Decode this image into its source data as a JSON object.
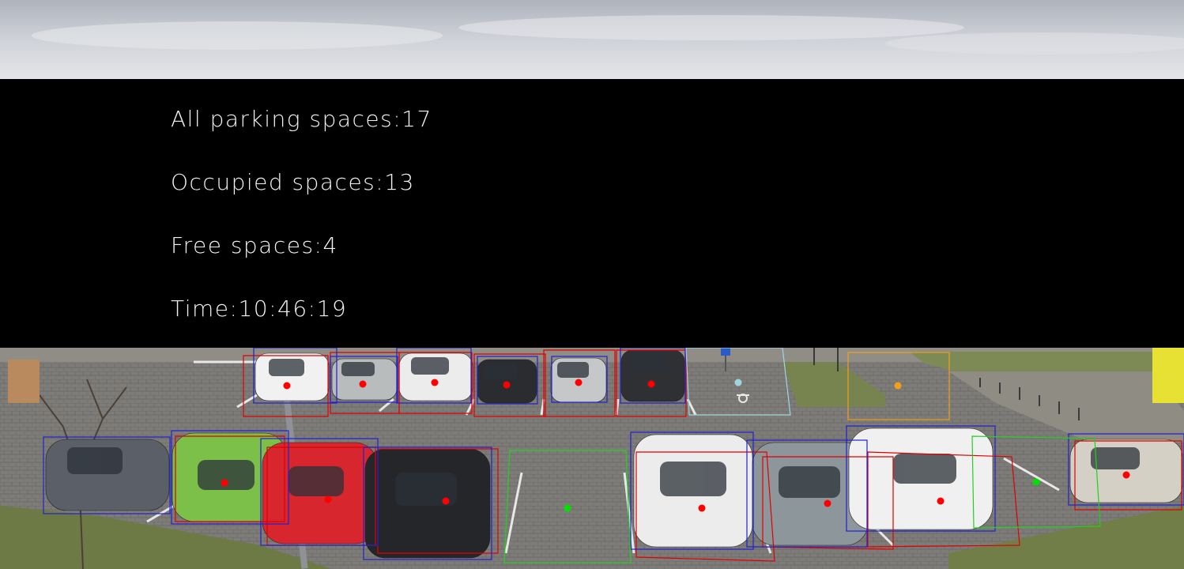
{
  "stats": {
    "all": "All parking spaces:17",
    "occupied": "Occupied spaces:13",
    "free": "Free spaces:4",
    "time": "Time:10:46:19"
  },
  "colors": {
    "occupied_box": "#e00000",
    "vehicle_box": "#2020d0",
    "free_box": "#22d022",
    "free_box_alt": "#9ed6e0",
    "free_box_reserved": "#f0a020",
    "occupied_dot": "#ff0000",
    "free_dot": "#00e000"
  },
  "cars": [
    {
      "color": "#f1f1f1"
    },
    {
      "color": "#b9bcbd"
    },
    {
      "color": "#ececec"
    },
    {
      "color": "#2a2c2f"
    },
    {
      "color": "#c5c7c8"
    },
    {
      "color": "#2e3034"
    },
    {
      "color": "#5b6068"
    },
    {
      "color": "#7cc04a"
    },
    {
      "color": "#d8262e"
    },
    {
      "color": "#24262a"
    },
    {
      "color": "#ececec"
    },
    {
      "color": "#8d969b"
    },
    {
      "color": "#f0f0f0"
    },
    {
      "color": "#d4d0c6"
    }
  ]
}
